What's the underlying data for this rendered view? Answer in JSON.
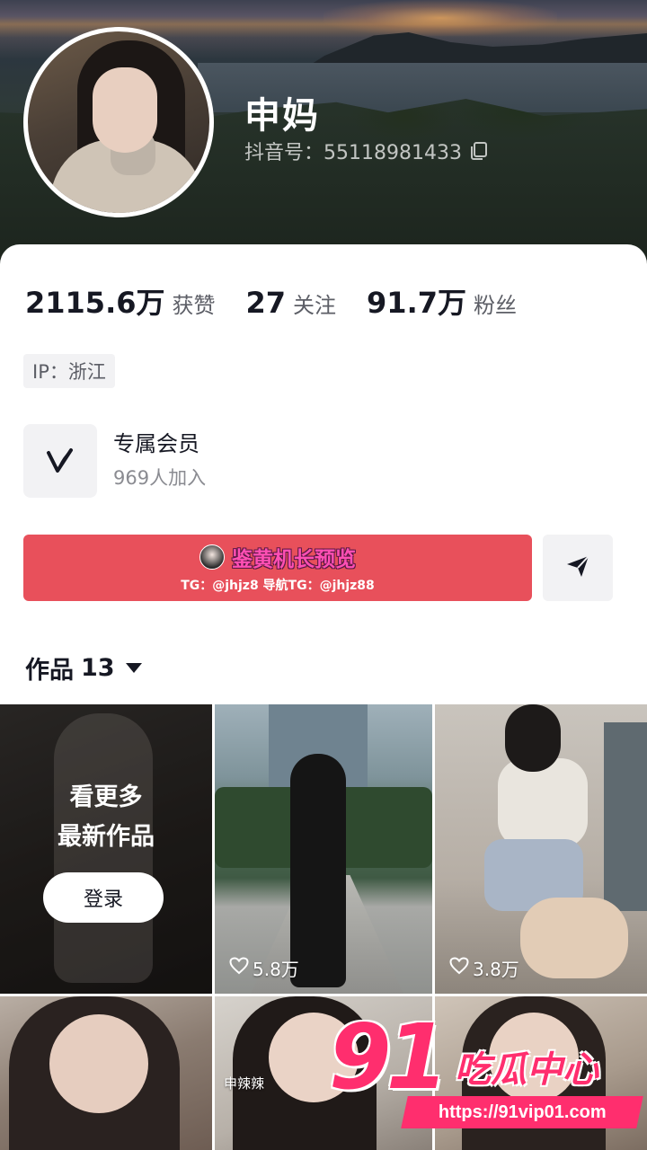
{
  "profile": {
    "name": "申妈",
    "douyin_id": "抖音号：55118981433"
  },
  "stats": [
    {
      "value": "2115.6万",
      "label": "获赞"
    },
    {
      "value": "27",
      "label": "关注"
    },
    {
      "value": "91.7万",
      "label": "粉丝"
    }
  ],
  "ip_tag": "IP：浙江",
  "membership": {
    "title": "专属会员",
    "subtitle": "969人加入"
  },
  "follow_button": {
    "title": "鉴黄机长预览",
    "subtitle": "TG：@jhjz8 导航TG：@jhjz88"
  },
  "works_tab": {
    "label": "作品",
    "count": "13"
  },
  "grid": {
    "promo_line1": "看更多",
    "promo_line2": "最新作品",
    "login_label": "登录",
    "tiles": [
      {
        "likes": "5.8万"
      },
      {
        "likes": "3.8万"
      }
    ],
    "caption": "申辣辣"
  },
  "watermark": {
    "logo_number": "91",
    "logo_text": "吃瓜中心",
    "url": "https://91vip01.com"
  },
  "colors": {
    "follow_button": "#e8505b",
    "watermark": "#ff2e6e"
  }
}
